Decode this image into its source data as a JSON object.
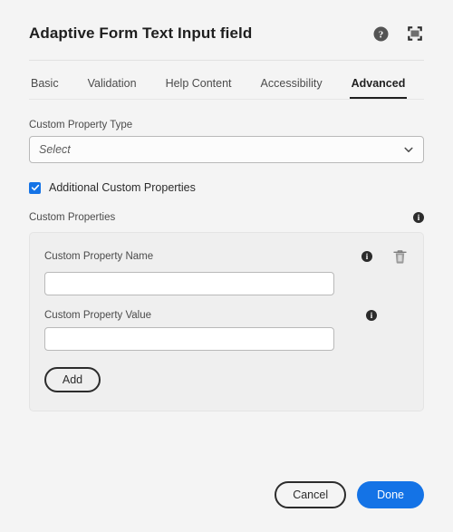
{
  "header": {
    "title": "Adaptive Form Text Input field",
    "help_icon": "help-circle-icon",
    "fullscreen_icon": "fullscreen-icon"
  },
  "tabs": [
    {
      "label": "Basic",
      "selected": false
    },
    {
      "label": "Validation",
      "selected": false
    },
    {
      "label": "Help Content",
      "selected": false
    },
    {
      "label": "Accessibility",
      "selected": false
    },
    {
      "label": "Advanced",
      "selected": true
    }
  ],
  "form": {
    "custom_property_type_label": "Custom Property Type",
    "custom_property_type_value": "Select",
    "additional_custom_properties_label": "Additional Custom Properties",
    "additional_custom_properties_checked": true,
    "custom_properties_section_label": "Custom Properties",
    "property_name_label": "Custom Property Name",
    "property_name_value": "",
    "property_name_placeholder": "",
    "property_value_label": "Custom Property Value",
    "property_value_value": "",
    "property_value_placeholder": "",
    "add_button_label": "Add",
    "delete_icon": "trash-icon",
    "info_icon": "info-icon"
  },
  "footer": {
    "cancel_label": "Cancel",
    "done_label": "Done"
  },
  "colors": {
    "accent_blue": "#1473E6",
    "page_background": "#F4F4F4",
    "card_background": "#EFEFEF",
    "text_primary": "#2C2C2C"
  }
}
